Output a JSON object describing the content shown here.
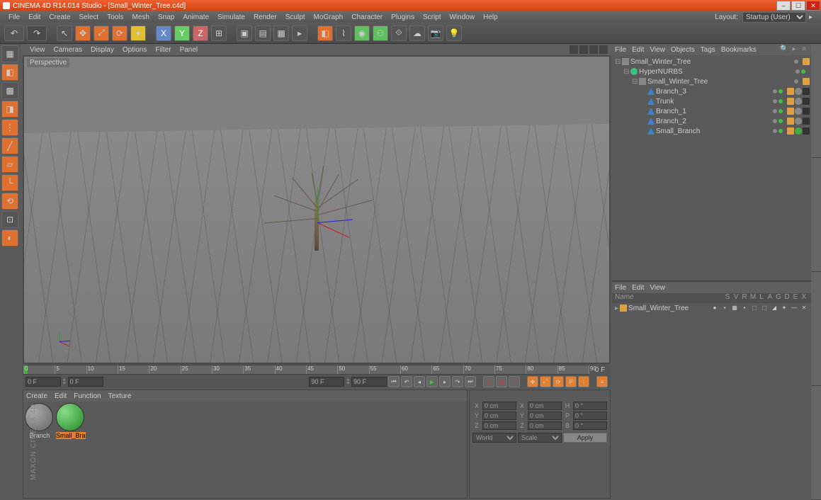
{
  "title": "CINEMA 4D R14.014 Studio - [Small_Winter_Tree.c4d]",
  "menu": [
    "File",
    "Edit",
    "Create",
    "Select",
    "Tools",
    "Mesh",
    "Snap",
    "Animate",
    "Simulate",
    "Render",
    "Sculpt",
    "MoGraph",
    "Character",
    "Plugins",
    "Script",
    "Window",
    "Help"
  ],
  "layout_label": "Layout:",
  "layout_value": "Startup (User)",
  "viewport_menu": [
    "View",
    "Cameras",
    "Display",
    "Options",
    "Filter",
    "Panel"
  ],
  "viewport_label": "Perspective",
  "obj_menu": [
    "File",
    "Edit",
    "View",
    "Objects",
    "Tags",
    "Bookmarks"
  ],
  "layer_menu": [
    "File",
    "Edit",
    "View"
  ],
  "mat_menu": [
    "Create",
    "Edit",
    "Function",
    "Texture"
  ],
  "timeline": {
    "start": "0 F",
    "field1": "0 F",
    "field2": "0 F",
    "field3": "90 F",
    "field4": "90 F",
    "ticks": [
      0,
      5,
      10,
      15,
      20,
      25,
      30,
      35,
      40,
      45,
      50,
      55,
      60,
      65,
      70,
      75,
      80,
      85,
      90
    ]
  },
  "objects": [
    {
      "indent": 0,
      "toggle": "⊟",
      "icon": "null",
      "name": "Small_Winter_Tree",
      "dots": 1,
      "tags": [
        "tag"
      ]
    },
    {
      "indent": 1,
      "toggle": "⊟",
      "icon": "nurbs",
      "name": "HyperNURBS",
      "dots": 2,
      "tags": []
    },
    {
      "indent": 2,
      "toggle": "⊟",
      "icon": "null",
      "name": "Small_Winter_Tree",
      "dots": 1,
      "tags": [
        "tag"
      ]
    },
    {
      "indent": 3,
      "toggle": "",
      "icon": "poly",
      "name": "Branch_3",
      "dots": 2,
      "tags": [
        "tag",
        "mat",
        "x"
      ]
    },
    {
      "indent": 3,
      "toggle": "",
      "icon": "poly",
      "name": "Trunk",
      "dots": 2,
      "tags": [
        "tag",
        "mat",
        "x"
      ]
    },
    {
      "indent": 3,
      "toggle": "",
      "icon": "poly",
      "name": "Branch_1",
      "dots": 2,
      "tags": [
        "tag",
        "mat",
        "x"
      ]
    },
    {
      "indent": 3,
      "toggle": "",
      "icon": "poly",
      "name": "Branch_2",
      "dots": 2,
      "tags": [
        "tag",
        "mat",
        "x"
      ]
    },
    {
      "indent": 3,
      "toggle": "",
      "icon": "poly",
      "name": "Small_Branch",
      "dots": 2,
      "tags": [
        "tag",
        "matg",
        "x"
      ]
    }
  ],
  "layer_header": {
    "name": "Name",
    "cols": [
      "S",
      "V",
      "R",
      "M",
      "L",
      "A",
      "G",
      "D",
      "E",
      "X"
    ]
  },
  "layers": [
    {
      "name": "Small_Winter_Tree"
    }
  ],
  "materials": [
    {
      "name": "Branch",
      "class": "branch",
      "selected": false
    },
    {
      "name": "Small_Bran",
      "class": "small",
      "selected": true
    }
  ],
  "coords": {
    "X": "0 cm",
    "Y": "0 cm",
    "Z": "0 cm",
    "X2": "0 cm",
    "Y2": "0 cm",
    "Z2": "0 cm",
    "H": "0 °",
    "P": "0 °",
    "B": "0 °",
    "mode1": "World",
    "mode2": "Scale",
    "apply": "Apply"
  },
  "watermark": "MAXON CINEMA 4D"
}
